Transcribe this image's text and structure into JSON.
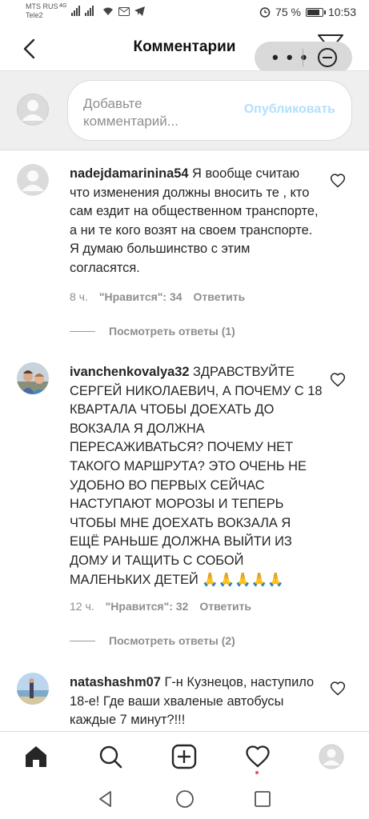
{
  "status_bar": {
    "carrier_1": "MTS RUS",
    "carrier_2": "Tele2",
    "network_1": "4G",
    "battery": "75 %",
    "time": "10:53",
    "icons": [
      "signal-icon",
      "wifi-icon",
      "message-icon",
      "telegram-icon",
      "alarm-icon",
      "battery-icon"
    ]
  },
  "header": {
    "title": "Комментарии",
    "back_icon": "back-arrow-icon",
    "more_label": "• • •"
  },
  "compose": {
    "placeholder": "Добавьте комментарий...",
    "publish_label": "Опубликовать"
  },
  "comments": [
    {
      "username": "nadejdamarinina54",
      "text": "Я вообще считаю что изменения должны вносить те , кто сам ездит на общественном транспорте, а ни те кого возят на своем транспорте. Я думаю большинство с этим согласятся.",
      "time": "8 ч.",
      "likes": "\"Нравится\": 34",
      "reply": "Ответить",
      "view_replies": "Посмотреть ответы (1)"
    },
    {
      "username": "ivanchenkovalya32",
      "text": "ЗДРАВСТВУЙТЕ СЕРГЕЙ НИКОЛАЕВИЧ, А ПОЧЕМУ С 18 КВАРТАЛА ЧТОБЫ ДОЕХАТЬ ДО ВОКЗАЛА Я ДОЛЖНА ПЕРЕСАЖИВАТЬСЯ? ПОЧЕМУ НЕТ ТАКОГО МАРШРУТА? ЭТО ОЧЕНЬ НЕ УДОБНО ВО ПЕРВЫХ СЕЙЧАС НАСТУПАЮТ МОРОЗЫ И ТЕПЕРЬ ЧТОБЫ МНЕ ДОЕХАТЬ ВОКЗАЛА Я ЕЩЁ РАНЬШЕ ДОЛЖНА ВЫЙТИ ИЗ ДОМУ И ТАЩИТЬ С СОБОЙ МАЛЕНЬКИХ ДЕТЕЙ 🙏🙏🙏🙏🙏",
      "time": "12 ч.",
      "likes": "\"Нравится\": 32",
      "reply": "Ответить",
      "view_replies": "Посмотреть ответы (2)"
    },
    {
      "username": "natashashm07",
      "text": "Г-н Кузнецов, наступило 18-е! Где ваши хваленые автобусы каждые 7 минут?!!!",
      "time": "",
      "likes": "",
      "reply": "",
      "view_replies": ""
    }
  ],
  "tabbar": [
    "home-icon",
    "search-icon",
    "new-post-icon",
    "activity-icon",
    "profile-icon"
  ],
  "system_nav": [
    "back-icon",
    "home-circle-icon",
    "recents-icon"
  ],
  "colors": {
    "publish_disabled": "#b2dffc",
    "secondary_text": "#8e8e8e",
    "notification_dot": "#ed4956"
  }
}
